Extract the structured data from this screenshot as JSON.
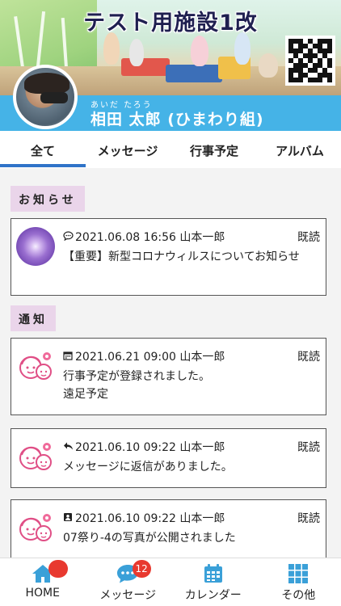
{
  "header": {
    "facility_name": "テスト用施設1改",
    "child_name_ruby": "あいだ たろう",
    "child_name": "相田 太郎 (ひまわり組)"
  },
  "tabs": [
    {
      "label": "全て",
      "active": true
    },
    {
      "label": "メッセージ",
      "active": false
    },
    {
      "label": "行事予定",
      "active": false
    },
    {
      "label": "アルバム",
      "active": false
    }
  ],
  "sections": {
    "notice_label": "お知らせ",
    "notification_label": "通知"
  },
  "notices": [
    {
      "icon": "comment-icon",
      "datetime": "2021.06.08 16:56",
      "author": "山本一郎",
      "status": "既読",
      "body": "【重要】新型コロナウィルスについてお知らせ"
    }
  ],
  "notifications": [
    {
      "icon": "calendar-icon",
      "datetime": "2021.06.21 09:00",
      "author": "山本一郎",
      "status": "既読",
      "body_line1": "行事予定が登録されました。",
      "body_line2": "遠足予定"
    },
    {
      "icon": "reply-icon",
      "datetime": "2021.06.10 09:22",
      "author": "山本一郎",
      "status": "既読",
      "body_line1": "メッセージに返信がありました。"
    },
    {
      "icon": "photo-album-icon",
      "datetime": "2021.06.10 09:22",
      "author": "山本一郎",
      "status": "既読",
      "body_line1": "07祭り-4の写真が公開されました"
    }
  ],
  "bottom_nav": [
    {
      "label": "HOME",
      "icon": "home-icon",
      "badge": ""
    },
    {
      "label": "メッセージ",
      "icon": "chat-icon",
      "badge": "12"
    },
    {
      "label": "カレンダー",
      "icon": "calendar-icon",
      "badge": ""
    },
    {
      "label": "その他",
      "icon": "grid-icon",
      "badge": ""
    }
  ],
  "colors": {
    "accent_blue": "#45b3e7",
    "tab_underline": "#2f73c8",
    "label_pink": "#ead5ea",
    "badge_red": "#e8392f"
  }
}
